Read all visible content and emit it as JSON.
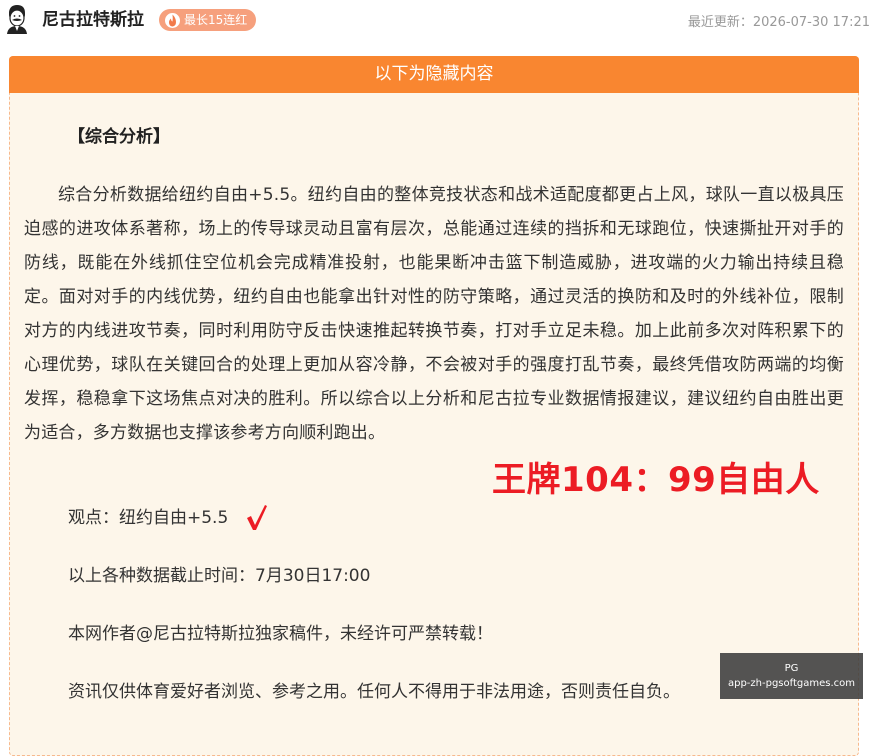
{
  "header": {
    "author_name": "尼古拉特斯拉",
    "streak_badge": "最长15连红",
    "updated": "最近更新：2026-07-30 17:21"
  },
  "panel": {
    "banner": "以下为隐藏内容",
    "section_title": "【综合分析】",
    "analysis": "综合分析数据给纽约自由+5.5。纽约自由的整体竞技状态和战术适配度都更占上风，球队一直以极具压迫感的进攻体系著称，场上的传导球灵动且富有层次，总能通过连续的挡拆和无球跑位，快速撕扯开对手的防线，既能在外线抓住空位机会完成精准投射，也能果断冲击篮下制造威胁，进攻端的火力输出持续且稳定。面对对手的内线优势，纽约自由也能拿出针对性的防守策略，通过灵活的换防和及时的外线补位，限制对方的内线进攻节奏，同时利用防守反击快速推起转换节奏，打对手立足未稳。加上此前多次对阵积累下的心理优势，球队在关键回合的处理上更加从容冷静，不会被对手的强度打乱节奏，最终凭借攻防两端的均衡发挥，稳稳拿下这场焦点对决的胜利。所以综合以上分析和尼古拉专业数据情报建议，建议纽约自由胜出更为适合，多方数据也支撑该参考方向顺利跑出。",
    "score_overlay": "王牌104：99自由人",
    "viewpoint": "观点：纽约自由+5.5",
    "cutoff": "以上各种数据截止时间：7月30日17:00",
    "copyright": "本网作者@尼古拉特斯拉独家稿件，未经许可严禁转载！",
    "disclaimer": "资讯仅供体育爱好者浏览、参考之用。任何人不得用于非法用途，否则责任自负。"
  },
  "watermark": {
    "line1": "PG",
    "line2": "app-zh-pgsoftgames.com"
  },
  "colors": {
    "banner": "#f98630",
    "panel_bg": "#fdf6ea",
    "badge": "#f6a07d",
    "overlay_red": "#ec1c24"
  },
  "icons": {
    "avatar": "portrait-avatar",
    "badge": "flame-icon",
    "check": "check-mark-icon"
  }
}
